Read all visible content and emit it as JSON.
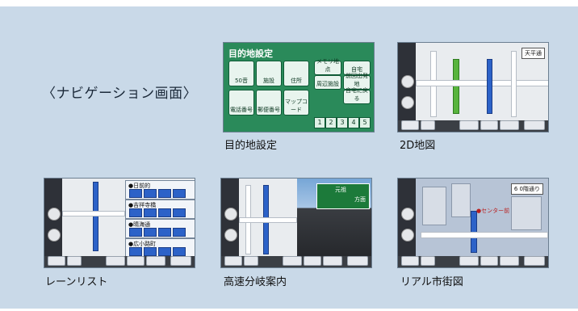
{
  "heading": "〈ナビゲーション画面〉",
  "captions": {
    "dest": "目的地設定",
    "map2d": "2D地図",
    "lane": "レーンリスト",
    "highway": "高速分岐案内",
    "real": "リアル市街図"
  },
  "dest_menu": {
    "title": "目的地設定",
    "tiles": [
      "50音",
      "施設",
      "住所",
      "メモリ地点",
      "自宅",
      "周辺施設",
      "前回出発地",
      "電話番号",
      "郵便番号",
      "マップコード",
      "自宅に戻る"
    ],
    "numbers": [
      "1",
      "2",
      "3",
      "4",
      "5"
    ]
  },
  "map2d": {
    "tag": "天平通"
  },
  "lane": {
    "items": [
      "●日前的",
      "●吉祥寺橋",
      "●晴海通",
      "●広小路町"
    ]
  },
  "highway": {
    "sign_title": "元祖",
    "sign_sub": "方面"
  },
  "real": {
    "tag": "6 0階通り",
    "label": "●センター前"
  },
  "bottom_bar": {
    "map2d": [
      "詳細",
      "40m",
      "表示変更",
      "周辺",
      "地点登録",
      "広域"
    ],
    "lane": [
      "詳細",
      "40m",
      "表示変更",
      "周辺",
      "地点登録",
      "広域"
    ],
    "highway": [
      "拡大",
      "40m",
      "表示変更",
      "周辺",
      "地点登録",
      "広域"
    ],
    "real": [
      "詳細",
      "40m",
      "表示変更",
      "周辺",
      "地点登録",
      "広域"
    ]
  }
}
